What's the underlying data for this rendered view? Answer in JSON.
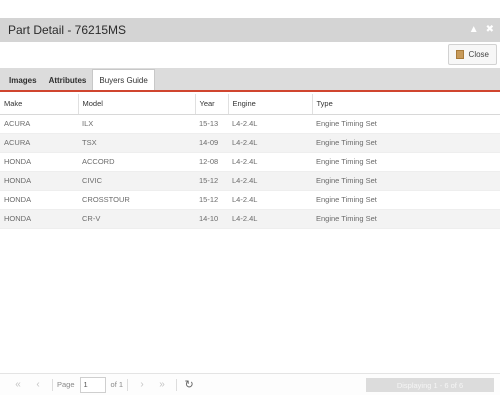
{
  "window": {
    "title": "Part Detail - 76215MS",
    "minimize_icon": "caret-up-icon",
    "close_icon": "x-icon"
  },
  "toolbar": {
    "close_label": "Close",
    "close_icon": "document-icon"
  },
  "tabs": [
    {
      "label": "Images",
      "active": false
    },
    {
      "label": "Attributes",
      "active": false
    },
    {
      "label": "Buyers Guide",
      "active": true
    }
  ],
  "table": {
    "columns": [
      "Make",
      "Model",
      "Year",
      "Engine",
      "Type"
    ],
    "rows": [
      [
        "ACURA",
        "ILX",
        "15-13",
        "L4-2.4L",
        "Engine Timing Set"
      ],
      [
        "ACURA",
        "TSX",
        "14-09",
        "L4-2.4L",
        "Engine Timing Set"
      ],
      [
        "HONDA",
        "ACCORD",
        "12-08",
        "L4-2.4L",
        "Engine Timing Set"
      ],
      [
        "HONDA",
        "CIVIC",
        "15-12",
        "L4-2.4L",
        "Engine Timing Set"
      ],
      [
        "HONDA",
        "CROSSTOUR",
        "15-12",
        "L4-2.4L",
        "Engine Timing Set"
      ],
      [
        "HONDA",
        "CR-V",
        "14-10",
        "L4-2.4L",
        "Engine Timing Set"
      ]
    ]
  },
  "pager": {
    "page_label": "Page",
    "page_value": "1",
    "of_label": "of 1",
    "display_text": "Displaying 1 - 6 of 6"
  },
  "colors": {
    "accent": "#d0452f",
    "titlebar": "#d4d4d4",
    "tabbar": "#dcdcdc"
  }
}
